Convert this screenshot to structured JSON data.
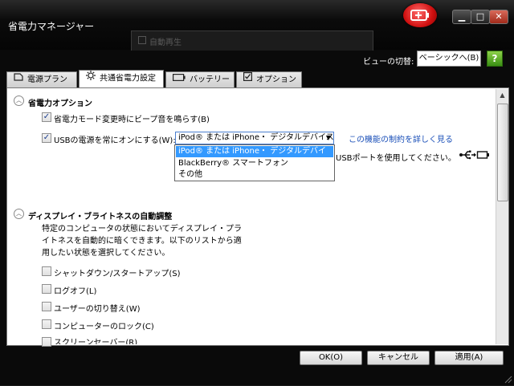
{
  "window": {
    "title": "省電力マネージャー",
    "background_window_title": "自動再生"
  },
  "window_controls": {
    "minimize": "▁",
    "maximize": "□",
    "close": "✕"
  },
  "view": {
    "label": "ビューの切替:",
    "button": "ベーシックへ(B)",
    "help": "?"
  },
  "tabs": [
    {
      "label": "電源プラン",
      "icon": "power-plan-icon"
    },
    {
      "label": "共通省電力設定",
      "icon": "gear-icon",
      "active": true
    },
    {
      "label": "バッテリー",
      "icon": "battery-icon"
    },
    {
      "label": "オプション",
      "icon": "checkbox-icon"
    }
  ],
  "sections": {
    "power_saving": {
      "header": "省電力オプション",
      "beep": {
        "label": "省電力モード変更時にビープ音を鳴らす(B)",
        "checked": true
      },
      "usb": {
        "label": "USBの電源を常にオンにする(W):",
        "checked": true,
        "combo_value": "iPod® または iPhone・ デジタルデバイス",
        "options": [
          "iPod® または iPhone・ デジタルデバイス",
          "BlackBerry® スマートフォン",
          "その他"
        ],
        "link": "この機能の制約を詳しく見る",
        "port_text": "USBポートを使用してください。"
      }
    },
    "brightness": {
      "header": "ディスプレイ・ブライトネスの自動調整",
      "description": [
        "特定のコンピュータの状態においてディスプレイ・プラ",
        "イトネスを自動的に暗くできます。以下のリストから適",
        "用したい状態を選択してください。"
      ],
      "items": [
        "シャットダウン/スタートアップ(S)",
        "ログオフ(L)",
        "ユーザーの切り替え(W)",
        "コンピューターのロック(C)",
        "スクリーンセーバー(R)"
      ]
    }
  },
  "buttons": {
    "ok": "OK(O)",
    "cancel": "キャンセル",
    "apply": "適用(A)"
  },
  "colors": {
    "accent": "#3399ff",
    "link": "#1a4fb8",
    "badge": "#d01010"
  }
}
